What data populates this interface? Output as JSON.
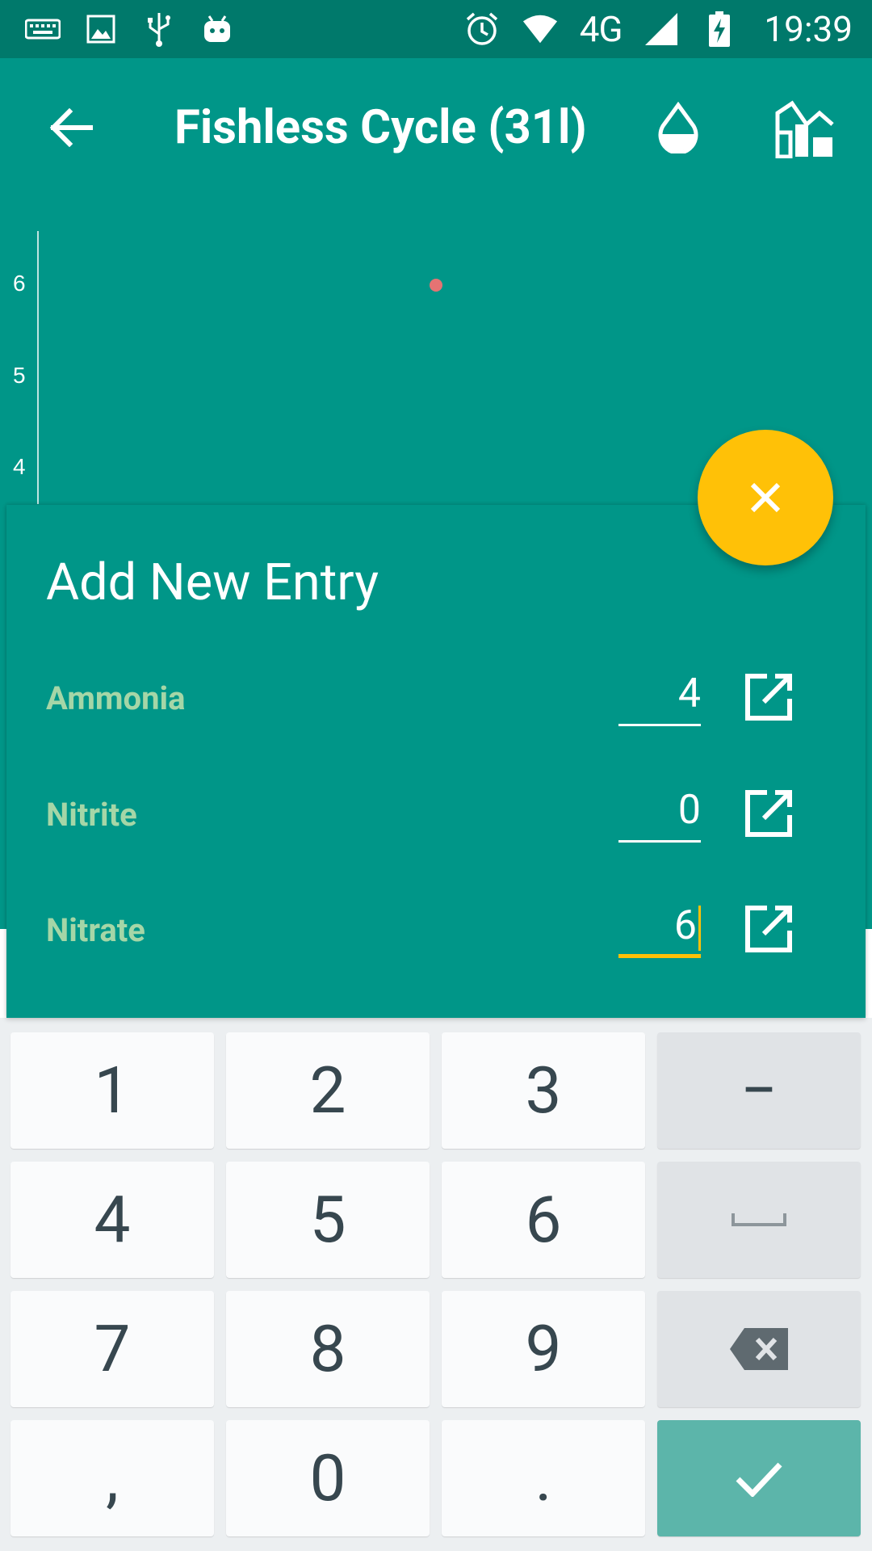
{
  "status_bar": {
    "time": "19:39",
    "network": "4G",
    "icons": [
      "keyboard-icon",
      "image-icon",
      "usb-icon",
      "android-icon",
      "alarm-icon",
      "wifi-icon",
      "signal-icon",
      "battery-charging-icon"
    ]
  },
  "app_bar": {
    "title": "Fishless Cycle (31l)",
    "icons": [
      "back-arrow-icon",
      "water-drop-icon",
      "chart-icon"
    ]
  },
  "chart": {
    "y_ticks": [
      "6",
      "5",
      "4"
    ],
    "point_color": "#e57373"
  },
  "fab": {
    "icon": "close-icon",
    "color": "#ffc107"
  },
  "entry_card": {
    "title": "Add New Entry",
    "rows": [
      {
        "label": "Ammonia",
        "value": "4"
      },
      {
        "label": "Nitrite",
        "value": "0"
      },
      {
        "label": "Nitrate",
        "value": "6"
      }
    ]
  },
  "keyboard": {
    "keys": [
      "1",
      "2",
      "3",
      "−",
      "4",
      "5",
      "6",
      "space",
      "7",
      "8",
      "9",
      "backspace",
      ",",
      "0",
      ".",
      "done"
    ],
    "labels": {
      "k1": "1",
      "k2": "2",
      "k3": "3",
      "kminus": "−",
      "k4": "4",
      "k5": "5",
      "k6": "6",
      "k7": "7",
      "k8": "8",
      "k9": "9",
      "kcomma": ",",
      "k0": "0",
      "kdot": "."
    }
  },
  "colors": {
    "primary": "#009688",
    "primary_dark": "#00796b",
    "accent": "#ffc107",
    "label_green": "#a5d6a7"
  }
}
